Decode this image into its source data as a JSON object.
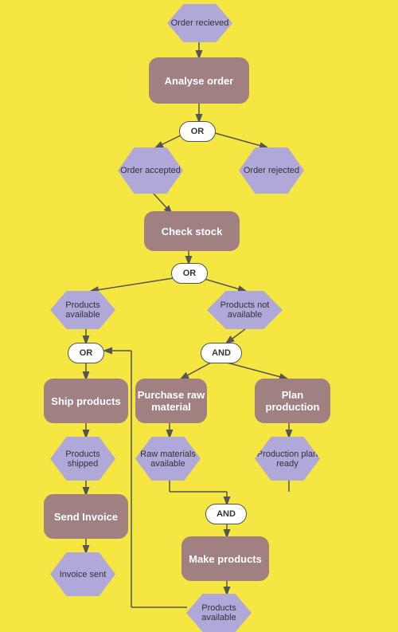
{
  "nodes": {
    "order_received": {
      "label": "Order recieved"
    },
    "analyse_order": {
      "label": "Analyse order"
    },
    "or1": {
      "label": "OR"
    },
    "order_accepted": {
      "label": "Order accepted"
    },
    "order_rejected": {
      "label": "Order rejected"
    },
    "check_stock": {
      "label": "Check stock"
    },
    "or2": {
      "label": "OR"
    },
    "products_available": {
      "label": "Products available"
    },
    "products_not_available": {
      "label": "Products not available"
    },
    "or3": {
      "label": "OR"
    },
    "and1": {
      "label": "AND"
    },
    "ship_products": {
      "label": "Ship products"
    },
    "purchase_raw": {
      "label": "Purchase raw material"
    },
    "plan_production": {
      "label": "Plan production"
    },
    "products_shipped": {
      "label": "Products shipped"
    },
    "raw_materials": {
      "label": "Raw materials available"
    },
    "production_plan": {
      "label": "Production plan ready"
    },
    "send_invoice": {
      "label": "Send Invoice"
    },
    "and2": {
      "label": "AND"
    },
    "make_products": {
      "label": "Make products"
    },
    "invoice_sent": {
      "label": "Invoice sent"
    },
    "products_available2": {
      "label": "Products available"
    }
  }
}
